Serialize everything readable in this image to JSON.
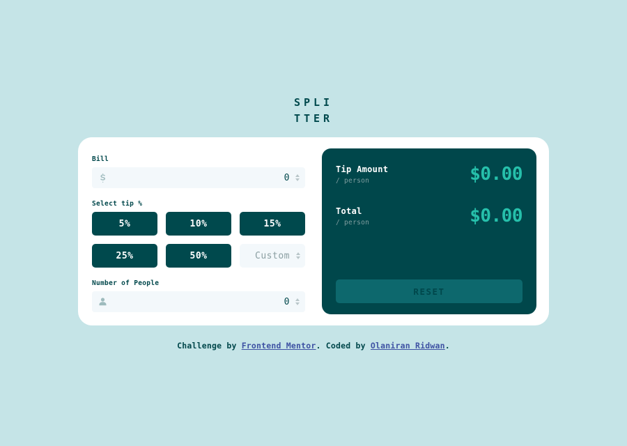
{
  "app": {
    "title_line1": "SPLI",
    "title_line2": "TTER"
  },
  "colors": {
    "page_background": "#C5E4E7",
    "card_background": "#FFFFFF",
    "panel_dark": "#00474B",
    "tip_button": "#00494D",
    "accent_mint": "#26C0AB",
    "input_background": "#F3F8FB",
    "reset_button": "#0D686D",
    "link": "#3E52A3"
  },
  "form": {
    "bill": {
      "label": "Bill",
      "icon": "dollar-icon",
      "value": "0",
      "placeholder": "0"
    },
    "tip": {
      "label": "Select tip %",
      "options": [
        {
          "label": "5%",
          "value": 5
        },
        {
          "label": "10%",
          "value": 10
        },
        {
          "label": "15%",
          "value": 15
        },
        {
          "label": "25%",
          "value": 25
        },
        {
          "label": "50%",
          "value": 50
        }
      ],
      "custom_placeholder": "Custom",
      "custom_value": ""
    },
    "people": {
      "label": "Number of People",
      "icon": "person-icon",
      "value": "0",
      "placeholder": "0"
    }
  },
  "results": {
    "rows": [
      {
        "label": "Tip Amount",
        "sub": "/ person",
        "value": "$0.00"
      },
      {
        "label": "Total",
        "sub": "/ person",
        "value": "$0.00"
      }
    ],
    "reset_label": "RESET"
  },
  "footer": {
    "text_1": "Challenge by ",
    "link_1": "Frontend Mentor",
    "text_2": ". Coded by ",
    "link_2": "Olaniran Ridwan",
    "text_3": "."
  }
}
